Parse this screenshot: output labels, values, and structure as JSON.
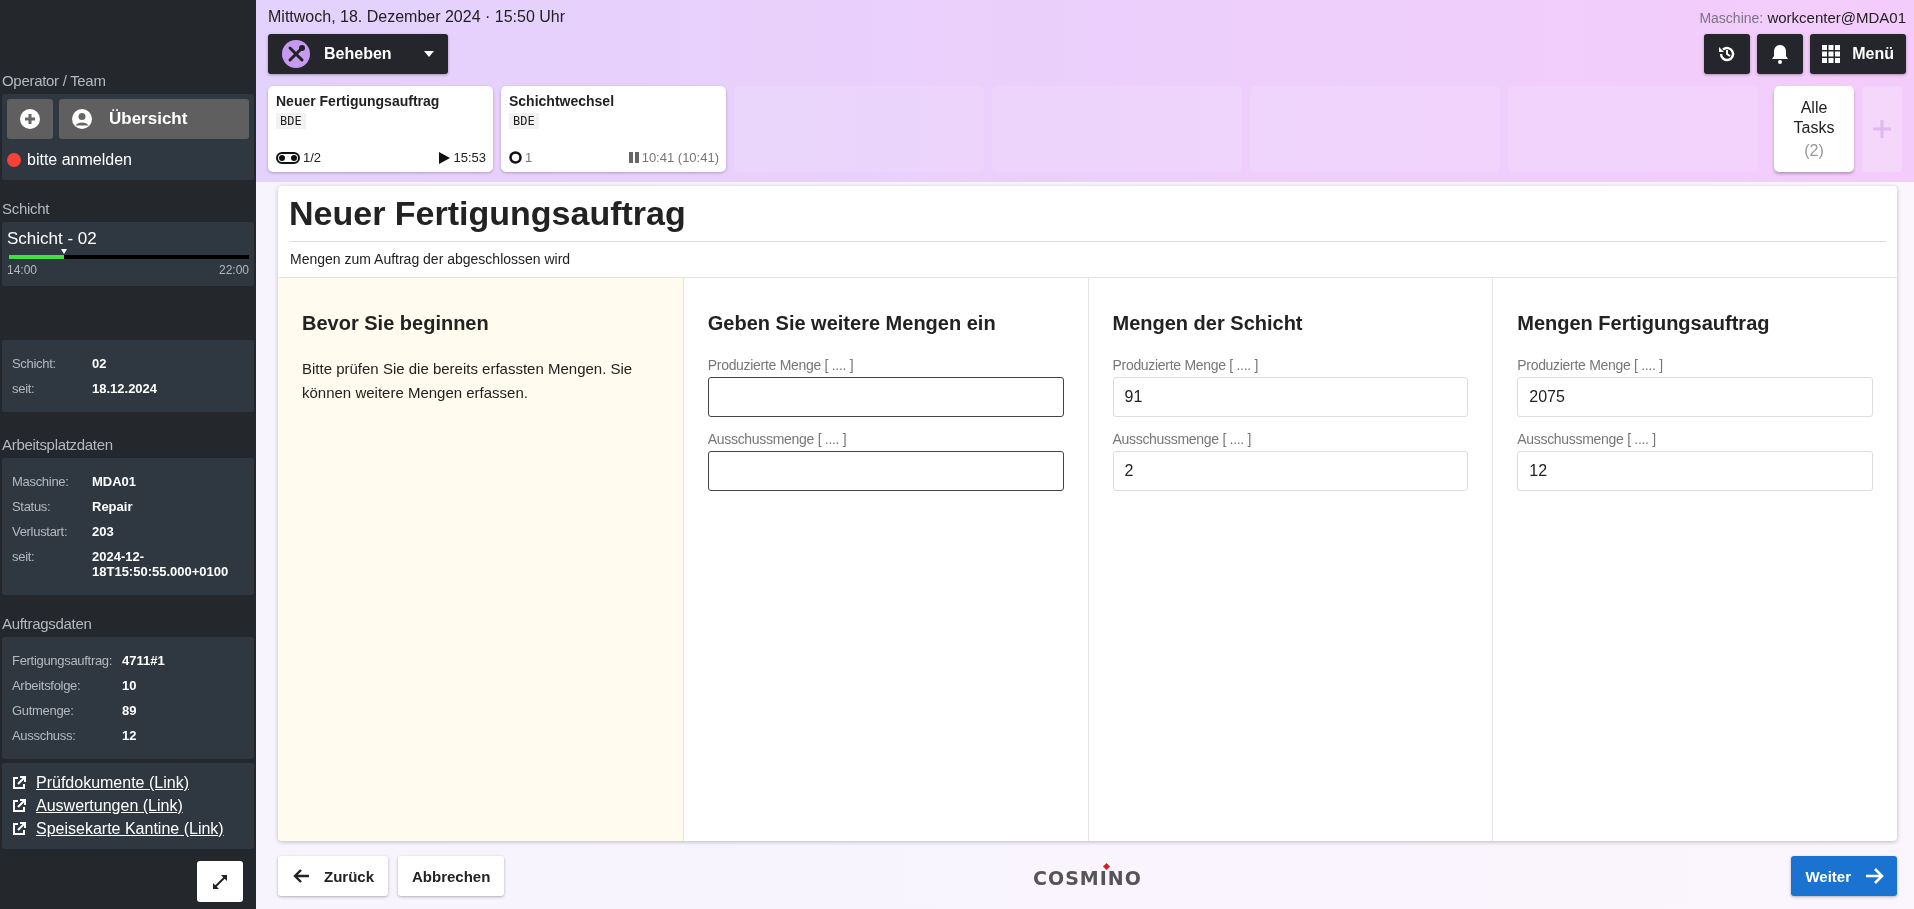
{
  "sidebar": {
    "operator": {
      "heading": "Operator / Team",
      "overview_button": "Übersicht",
      "login_status": "bitte anmelden",
      "color": "#f44336"
    },
    "shift": {
      "heading": "Schicht",
      "name": "Schicht - 02",
      "level": 0.23,
      "start": "14:00",
      "end": "22:00"
    },
    "shift_info": [
      {
        "label": "Schicht:",
        "value": "02"
      },
      {
        "label": "seit:",
        "value": "18.12.2024"
      }
    ],
    "workplace": {
      "heading": "Arbeitsplatzdaten",
      "rows": [
        {
          "label": "Maschine:",
          "value": "MDA01"
        },
        {
          "label": "Status:",
          "value": "Repair"
        },
        {
          "label": "Verlustart:",
          "value": "203"
        },
        {
          "label": "seit:",
          "value": "2024-12-18T15:50:55.000+0100"
        }
      ]
    },
    "order": {
      "heading": "Auftragsdaten",
      "rows": [
        {
          "label": "Fertigungsauftrag:",
          "value": "4711#1"
        },
        {
          "label": "Arbeitsfolge:",
          "value": "10"
        },
        {
          "label": "Gutmenge:",
          "value": "89"
        },
        {
          "label": "Ausschuss:",
          "value": "12"
        }
      ]
    },
    "links": [
      "Prüfdokumente (Link)",
      "Auswertungen (Link)",
      "Speisekarte Kantine (Link)"
    ]
  },
  "header": {
    "datetime": "Mittwoch, 18. Dezember 2024 · 15:50 Uhr",
    "machine_label": "Maschine:",
    "machine": "workcenter@MDA01",
    "mode_button": "Beheben",
    "menu_button": "Menü"
  },
  "tasks": [
    {
      "title": "Neuer Fertigungsauftrag",
      "tag": "BDE",
      "progress": "1/2",
      "kind": "toggle",
      "time": "15:53",
      "paused": false
    },
    {
      "title": "Schichtwechsel",
      "tag": "BDE",
      "progress": "1",
      "kind": "ring",
      "time": "10:41 (10:41)",
      "paused": true
    }
  ],
  "all_tasks": {
    "label": "Alle Tasks",
    "count": "(2)"
  },
  "form": {
    "title": "Neuer Fertigungsauftrag",
    "subtitle": "Mengen zum Auftrag der abgeschlossen wird",
    "columns": [
      {
        "kind": "info",
        "heading": "Bevor Sie beginnen",
        "text": "Bitte prüfen Sie die bereits erfassten Mengen. Sie können weitere Mengen erfassen."
      },
      {
        "kind": "fields",
        "heading": "Geben Sie weitere Mengen ein",
        "fields": [
          {
            "label": "Produzierte Menge [ .... ]",
            "readonly": false
          },
          {
            "label": "Ausschussmenge [ .... ]",
            "readonly": false
          }
        ]
      },
      {
        "kind": "fields",
        "heading": "Mengen der Schicht",
        "fields": [
          {
            "label": "Produzierte Menge [ .... ]",
            "value": "91",
            "readonly": true
          },
          {
            "label": "Ausschussmenge [ .... ]",
            "value": "2",
            "readonly": true
          }
        ]
      },
      {
        "kind": "fields",
        "heading": "Mengen Fertigungsauftrag",
        "fields": [
          {
            "label": "Produzierte Menge [ .... ]",
            "value": "2075",
            "readonly": true
          },
          {
            "label": "Ausschussmenge [ .... ]",
            "value": "12",
            "readonly": true
          }
        ]
      }
    ]
  },
  "footer": {
    "back_button": "Zurück",
    "cancel_button": "Abbrechen",
    "logo": "COSMINO",
    "next_button": "Weiter"
  }
}
